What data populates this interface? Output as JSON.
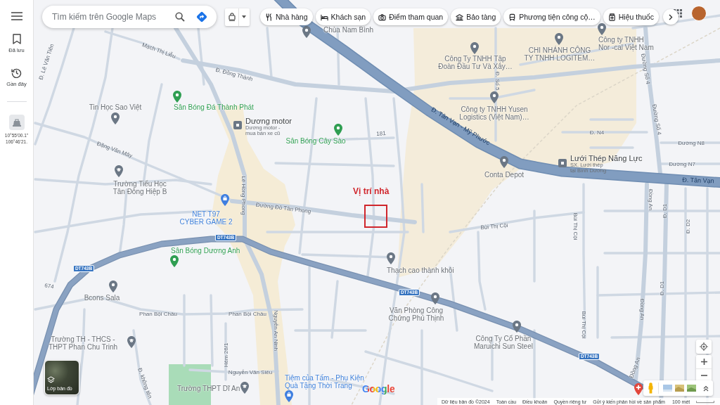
{
  "sidebar": {
    "items": [
      {
        "label": "Đã lưu",
        "kind": "saved"
      },
      {
        "label": "Gần đây",
        "kind": "recent"
      }
    ],
    "recent_place": {
      "coordinates": [
        "10°55'00.1\"",
        "106°46'21."
      ]
    }
  },
  "search": {
    "placeholder": "Tìm kiếm trên Google Maps"
  },
  "chips": [
    {
      "label": "Nhà hàng",
      "kind": "restaurant"
    },
    {
      "label": "Khách sạn",
      "kind": "hotel"
    },
    {
      "label": "Điểm tham quan",
      "kind": "attraction"
    },
    {
      "label": "Bảo tàng",
      "kind": "museum"
    },
    {
      "label": "Phương tiện công cộ…",
      "kind": "transit"
    },
    {
      "label": "Hiệu thuốc",
      "kind": "pharmacy"
    }
  ],
  "map": {
    "places": [
      {
        "kind": "pin",
        "lines": [
          "Chùa Nam Bình"
        ]
      },
      {
        "kind": "pin",
        "lines": [
          "Công ty TNHH",
          "Nor -cal Việt Nam"
        ]
      },
      {
        "kind": "pin",
        "lines": [
          "CHI NHÁNH CÔNG",
          "TY TNHH LOGITEM…"
        ]
      },
      {
        "kind": "pin",
        "lines": [
          "Công Ty TNHH Tập",
          "Đoàn Đầu Tư Và Xây…"
        ]
      },
      {
        "kind": "pin",
        "lines": [
          "Tin Học Sao Việt"
        ]
      },
      {
        "kind": "sport",
        "lines": [
          "Sân Bóng Đá Thành Phát"
        ]
      },
      {
        "kind": "pin",
        "lines": [
          "Công ty TNHH Yusen",
          "Logistics (Việt Nam)…"
        ]
      },
      {
        "kind": "store",
        "lines": [
          "Dương motor"
        ],
        "sub": [
          "Dương motor -",
          "mua bán xe cũ"
        ]
      },
      {
        "kind": "sport",
        "lines": [
          "Sân Bóng Cây Sào"
        ]
      },
      {
        "kind": "store",
        "lines": [
          "Lưới Thép Năng Lực"
        ],
        "sub": [
          "SX. Lưới thép",
          "tại Bình Dương"
        ]
      },
      {
        "kind": "pin",
        "lines": [
          "Conta Depot"
        ]
      },
      {
        "kind": "school",
        "lines": [
          "Trường Tiểu Học",
          "Tân Đông Hiệp B"
        ]
      },
      {
        "kind": "shop",
        "lines": [
          "NET T97",
          "CYBER GAME 2"
        ]
      },
      {
        "kind": "sport",
        "lines": [
          "Sân Bóng Dương Anh"
        ]
      },
      {
        "kind": "pin",
        "lines": [
          "Thạch cao thành khôi"
        ]
      },
      {
        "kind": "pin",
        "lines": [
          "Bcons Sala"
        ]
      },
      {
        "kind": "pin",
        "lines": [
          "Văn Phòng Công",
          "Chứng Phú Thịnh"
        ]
      },
      {
        "kind": "school",
        "lines": [
          "Trường TH - THCS -",
          "THPT Phan Chu Trinh"
        ]
      },
      {
        "kind": "pin",
        "lines": [
          "Công Ty Cổ Phần",
          "Maruichi Sun Steel"
        ]
      },
      {
        "kind": "school",
        "lines": [
          "Trường THPT Dĩ An"
        ]
      },
      {
        "kind": "shop",
        "lines": [
          "Tiệm của Tấm - Phụ Kiện",
          "Quà Tặng Thời Trang"
        ]
      },
      {
        "kind": "hospital"
      }
    ],
    "streets": [
      {
        "name": "Mạch Thị Liễu",
        "kind": "street"
      },
      {
        "name": "Đ. Lê Văn Tiên",
        "kind": "street"
      },
      {
        "name": "Đ. Đồng Thành",
        "kind": "street"
      },
      {
        "name": "Đặng Văn Mây",
        "kind": "street"
      },
      {
        "name": "Lê Hồng Phong",
        "kind": "street"
      },
      {
        "name": "Đường Đô Tân Phong",
        "kind": "street"
      },
      {
        "name": "Đ. Tân Vạn - Mỹ Phước",
        "kind": "highway"
      },
      {
        "name": "Đ. Tân Vạn",
        "kind": "highway"
      },
      {
        "name": "181",
        "kind": "street"
      },
      {
        "name": "Đ. N4",
        "kind": "street"
      },
      {
        "name": "Đường N8",
        "kind": "street"
      },
      {
        "name": "Đường N7",
        "kind": "street"
      },
      {
        "name": "Đường Số 4",
        "kind": "street"
      },
      {
        "name": "Đường Số 4",
        "kind": "street"
      },
      {
        "name": "Đ. Số 5",
        "kind": "street"
      },
      {
        "name": "Bùi Thị Cội",
        "kind": "street"
      },
      {
        "name": "Bùi Thị Cội",
        "kind": "street"
      },
      {
        "name": "Bùi Thị Cội",
        "kind": "street"
      },
      {
        "name": "Đồng An",
        "kind": "street"
      },
      {
        "name": "Đồng An",
        "kind": "street"
      },
      {
        "name": "Đồng An",
        "kind": "street"
      },
      {
        "name": "Đ. D1",
        "kind": "street"
      },
      {
        "name": "Đ. D1",
        "kind": "street"
      },
      {
        "name": "Đ. D2",
        "kind": "street"
      },
      {
        "name": "Nguyễn An Ninh",
        "kind": "street"
      },
      {
        "name": "Hẻm 26/1",
        "kind": "street"
      },
      {
        "name": "Nguyễn Văn Siêu",
        "kind": "street"
      },
      {
        "name": "Phan Bội Châu",
        "kind": "street"
      },
      {
        "name": "Phan Bội Châu",
        "kind": "street"
      },
      {
        "name": "Đ. không tên",
        "kind": "street"
      },
      {
        "name": "674",
        "kind": "street"
      }
    ],
    "route_shields": [
      "DT743B",
      "DT743B",
      "DT743B",
      "DT743B"
    ],
    "annotation": {
      "label": "Vị trí nhà"
    },
    "logo": "Google"
  },
  "layers_button": {
    "label": "Lớp bản đồ"
  },
  "footer": {
    "links": [
      "Dữ liệu bản đồ ©2024",
      "Toàn cầu",
      "Điều khoản",
      "Quyền riêng tư",
      "Gửi ý kiến phản hồi về sản phẩm"
    ],
    "scale": "100 mét"
  }
}
